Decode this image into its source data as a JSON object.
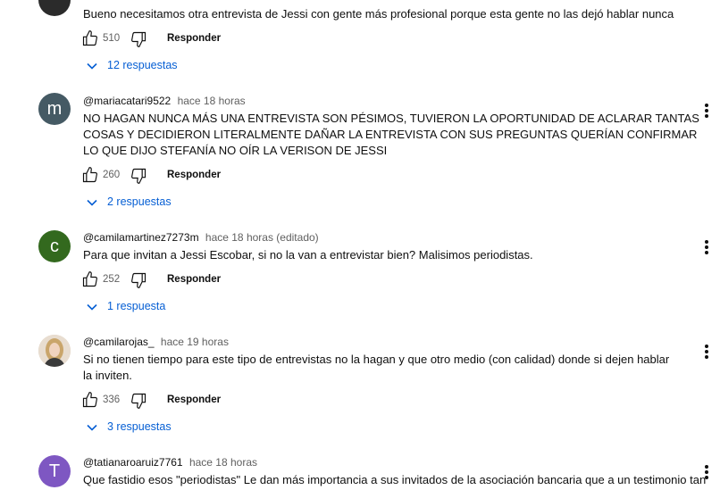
{
  "comments": [
    {
      "author": "",
      "time": "",
      "text": "Bueno necesitamos otra entrevista de Jessi con gente más profesional porque esta gente no las dejó hablar nunca",
      "likes": "510",
      "reply_label": "Responder",
      "replies_label": "12 respuestas",
      "avatar_color": "#2b2b2b",
      "avatar_letter": ""
    },
    {
      "author": "@mariacatari9522",
      "time": "hace 18 horas",
      "text": "NO HAGAN NUNCA MÁS UNA ENTREVISTA SON PÉSIMOS, TUVIERON LA OPORTUNIDAD DE ACLARAR TANTAS COSAS Y DECIDIERON LITERALMENTE DAÑAR LA ENTREVISTA CON SUS PREGUNTAS QUERÍAN CONFIRMAR LO QUE DIJO STEFANÍA NO OÍR LA VERISON DE JESSI",
      "likes": "260",
      "reply_label": "Responder",
      "replies_label": "2 respuestas",
      "avatar_color": "#455a64",
      "avatar_letter": "m"
    },
    {
      "author": "@camilamartinez7273m",
      "time": "hace 18 horas (editado)",
      "text": "Para que invitan a Jessi Escobar, si no la van a entrevistar bien? Malisimos periodistas.",
      "likes": "252",
      "reply_label": "Responder",
      "replies_label": "1 respuesta",
      "avatar_color": "#33691e",
      "avatar_letter": "c"
    },
    {
      "author": "@camilarojas_",
      "time": "hace 19 horas",
      "text": "Si no tienen tiempo para este tipo de entrevistas no la hagan y que otro medio (con calidad) donde si dejen hablar la inviten.",
      "likes": "336",
      "reply_label": "Responder",
      "replies_label": "3 respuestas",
      "avatar_color": "#c9b79c",
      "avatar_letter": ""
    },
    {
      "author": "@tatianaroaruiz7761",
      "time": "hace 18 horas",
      "text": "Que fastidio esos \"periodistas\" Le dan más importancia a sus invitados de la asociación bancaria que a un testimonio tan",
      "likes": "",
      "reply_label": "",
      "replies_label": "",
      "avatar_color": "#7e57c2",
      "avatar_letter": "T"
    }
  ]
}
